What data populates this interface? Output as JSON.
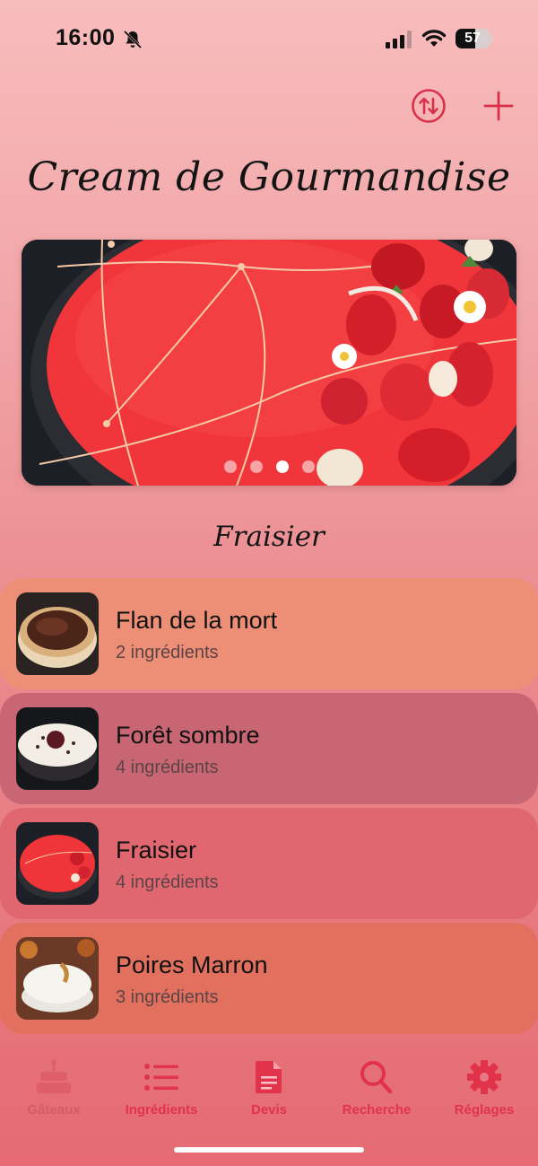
{
  "status_bar": {
    "time": "16:00",
    "battery": "57",
    "battery_level": 0.57
  },
  "toolbar": {
    "sort_icon": "sort-arrows-icon",
    "add_icon": "plus-icon"
  },
  "app_title": "Cream de Gourmandise",
  "carousel": {
    "caption": "Fraisier",
    "page_count": 4,
    "current_page": 3
  },
  "cakes": [
    {
      "name": "Flan de la mort",
      "ingredients": "2 ingrédients",
      "color": "#ec8f76"
    },
    {
      "name": "Forêt sombre",
      "ingredients": "4 ingrédients",
      "color": "#c86674"
    },
    {
      "name": "Fraisier",
      "ingredients": "4 ingrédients",
      "color": "#e06670"
    },
    {
      "name": "Poires Marron",
      "ingredients": "3 ingrédients",
      "color": "#e2705e"
    }
  ],
  "tabs": [
    {
      "label": "Gâteaux",
      "icon": "cake-icon",
      "active": false
    },
    {
      "label": "Ingrédients",
      "icon": "list-icon",
      "active": true
    },
    {
      "label": "Devis",
      "icon": "document-icon",
      "active": true
    },
    {
      "label": "Recherche",
      "icon": "search-icon",
      "active": true
    },
    {
      "label": "Réglages",
      "icon": "gear-icon",
      "active": true
    }
  ],
  "colors": {
    "accent": "#e1334a",
    "title": "#141414"
  }
}
